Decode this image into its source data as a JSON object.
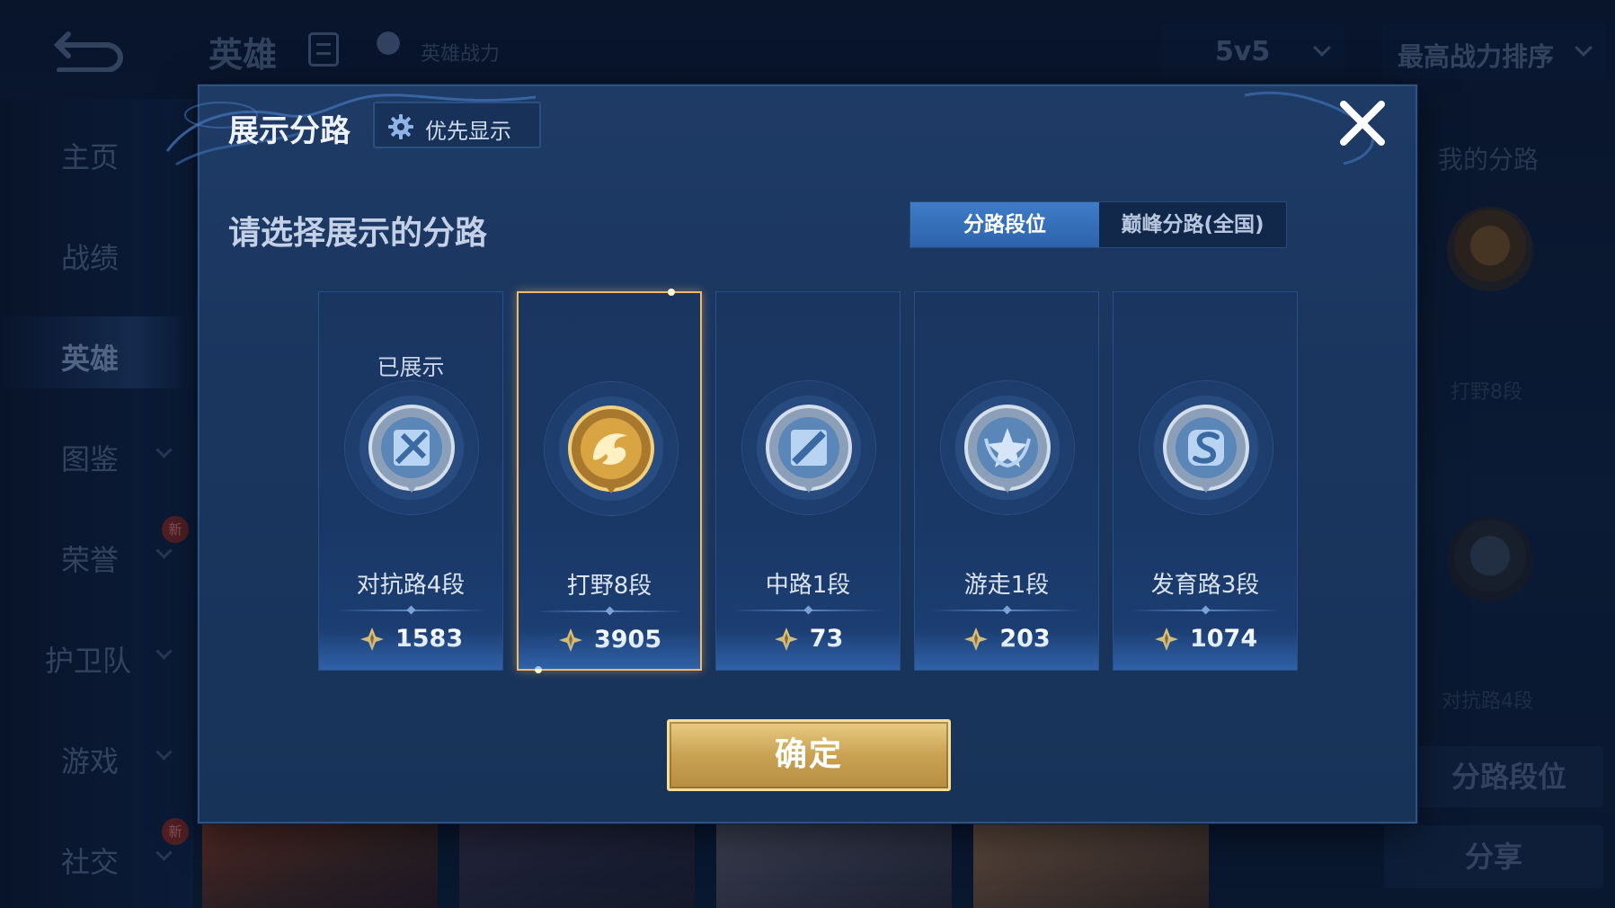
{
  "topbar": {
    "title": "英雄",
    "hero_power_label": "英雄战力",
    "mode_select": "5v5",
    "sort_select": "最高战力排序"
  },
  "sidebar": {
    "items": [
      {
        "label": "主页"
      },
      {
        "label": "战绩"
      },
      {
        "label": "英雄"
      },
      {
        "label": "图鉴"
      },
      {
        "label": "荣誉",
        "badge": "新"
      },
      {
        "label": "护卫队"
      },
      {
        "label": "游戏"
      },
      {
        "label": "社交",
        "badge": "新"
      }
    ]
  },
  "right_panel": {
    "title": "我的分路",
    "sub1": "打野8段",
    "sub2": "对抗路4段",
    "button1": "分路段位",
    "button2": "分享"
  },
  "modal": {
    "title": "展示分路",
    "priority_button": "优先显示",
    "subtitle": "请选择展示的分路",
    "tabs": [
      "分路段位",
      "巅峰分路(全国)"
    ],
    "active_tab": "分路段位",
    "confirm": "确定",
    "cards": [
      {
        "status": "已展示",
        "name": "对抗路4段",
        "score": "1583",
        "emblem": "clash-lane-icon",
        "tier": "silver"
      },
      {
        "status": "",
        "name": "打野8段",
        "score": "3905",
        "emblem": "jungle-dragon-icon",
        "tier": "gold",
        "selected": true
      },
      {
        "status": "",
        "name": "中路1段",
        "score": "73",
        "emblem": "mid-lane-icon",
        "tier": "silver"
      },
      {
        "status": "",
        "name": "游走1段",
        "score": "203",
        "emblem": "roam-icon",
        "tier": "silver"
      },
      {
        "status": "",
        "name": "发育路3段",
        "score": "1074",
        "emblem": "farm-lane-icon",
        "tier": "silver"
      }
    ]
  },
  "colors": {
    "accent_blue": "#3f7cc8",
    "selection_gold": "#f0b868",
    "confirm_gold": "#c9a253"
  }
}
